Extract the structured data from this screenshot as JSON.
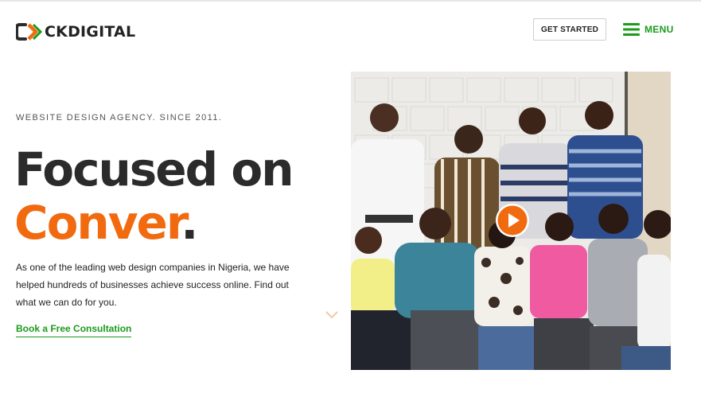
{
  "header": {
    "logo_text": "CKDIGITAL",
    "get_started_label": "GET STARTED",
    "menu_label": "MENU"
  },
  "hero": {
    "kicker": "WEBSITE DESIGN AGENCY. SINCE 2011.",
    "headline_line1": "Focused on",
    "headline_accent": "Conver",
    "headline_dot": ".",
    "description": "As one of the leading web design companies in Nigeria, we have helped hundreds of businesses achieve success online. Find out what we can do for you.",
    "cta_label": "Book a Free Consultation"
  },
  "icons": {
    "logo": "ck-logo-icon",
    "menu": "hamburger-icon",
    "scroll": "chevron-down-icon",
    "play": "play-icon"
  },
  "colors": {
    "accent_orange": "#f26a0f",
    "accent_green": "#1a9b1a",
    "text_dark": "#2b2b2b"
  }
}
